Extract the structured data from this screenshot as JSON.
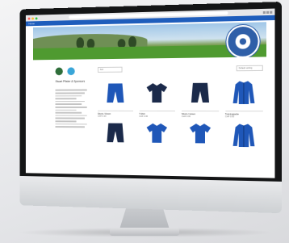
{
  "colors": {
    "brand_blue": "#1e5dbc",
    "navy": "#1b2a4a",
    "royal": "#1f57b8"
  },
  "browser": {
    "url": "",
    "dots": [
      "#ff5f57",
      "#febc2e",
      "#28c840"
    ]
  },
  "nav": {
    "label": "Home"
  },
  "sidebar": {
    "title": "Stuart Pfister & Sponsors",
    "text_lines": 14,
    "icons": [
      "club-crest-icon",
      "partner-logo-icon"
    ]
  },
  "filters": {
    "left": "Sort",
    "right": "Default sorting"
  },
  "products": [
    {
      "name": "Shorts / Hosen",
      "price": "CHF 0.00",
      "kind": "shorts",
      "color": "#1f57b8"
    },
    {
      "name": "T-Shirt",
      "price": "CHF 0.00",
      "kind": "tshirt",
      "color": "#1b2a4a"
    },
    {
      "name": "Shorts / Hosen",
      "price": "CHF 0.00",
      "kind": "shorts",
      "color": "#1b2a4a"
    },
    {
      "name": "Trainingsjacke",
      "price": "CHF 0.00",
      "kind": "jacket",
      "color": "#1f57b8"
    }
  ],
  "products_row2": [
    {
      "kind": "shorts",
      "color": "#1b2a4a"
    },
    {
      "kind": "tshirt",
      "color": "#1f57b8"
    },
    {
      "kind": "tshirt",
      "color": "#1f57b8"
    },
    {
      "kind": "jacket",
      "color": "#1f57b8"
    }
  ]
}
